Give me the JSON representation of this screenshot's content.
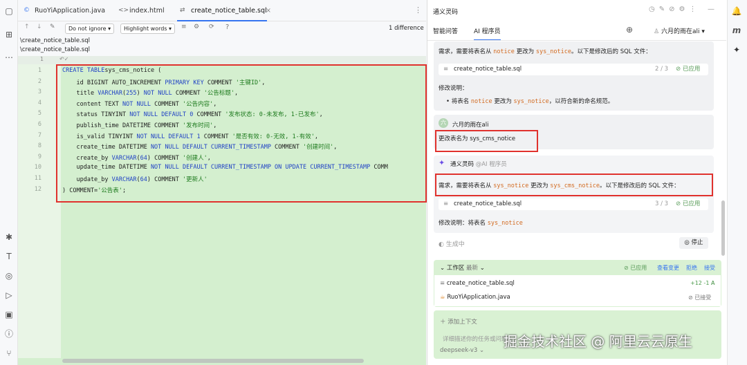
{
  "editor": {
    "tabs": [
      {
        "label": "RuoYiApplication.java",
        "icon": "java-icon"
      },
      {
        "label": "index.html",
        "icon": "html-icon"
      },
      {
        "label": "create_notice_table.sql",
        "icon": "diff-icon"
      }
    ],
    "toolbar": {
      "whitespace": "Do not ignore",
      "highlight": "Highlight words",
      "help": "?",
      "diff_count": "1 difference"
    },
    "paths": [
      "\\create_notice_table.sql",
      "\\create_notice_table.sql"
    ],
    "line_numbers": [
      "1",
      "2",
      "3",
      "4",
      "5",
      "6",
      "7",
      "8",
      "9",
      "10",
      "11",
      "12"
    ],
    "code": [
      [
        [
          "kw",
          "CREATE TABLE"
        ],
        [
          "",
          "sys_cms_notice ("
        ]
      ],
      [
        [
          "",
          "    id BIGINT AUTO_INCREMENT "
        ],
        [
          "kw",
          "PRIMARY KEY"
        ],
        [
          "",
          " COMMENT "
        ],
        [
          "str",
          "'主键ID'"
        ],
        [
          "",
          ","
        ]
      ],
      [
        [
          "",
          "    title "
        ],
        [
          "kw",
          "VARCHAR"
        ],
        [
          "",
          "("
        ],
        [
          "num",
          "255"
        ],
        [
          ") ",
          ""
        ],
        [
          "kw",
          "NOT NULL"
        ],
        [
          "",
          " COMMENT "
        ],
        [
          "str",
          "'公告标题'"
        ],
        [
          "",
          ","
        ]
      ],
      [
        [
          "",
          "    content TEXT "
        ],
        [
          "kw",
          "NOT NULL"
        ],
        [
          "",
          " COMMENT "
        ],
        [
          "str",
          "'公告内容'"
        ],
        [
          "",
          ","
        ]
      ],
      [
        [
          "",
          "    status TINYINT "
        ],
        [
          "kw",
          "NOT NULL DEFAULT 0"
        ],
        [
          "",
          " COMMENT "
        ],
        [
          "str",
          "'发布状态: 0-未发布, 1-已发布'"
        ],
        [
          "",
          ","
        ]
      ],
      [
        [
          "",
          "    publish_time DATETIME COMMENT "
        ],
        [
          "str",
          "'发布时间'"
        ],
        [
          "",
          ","
        ]
      ],
      [
        [
          "",
          "    is_valid TINYINT "
        ],
        [
          "kw",
          "NOT NULL DEFAULT 1"
        ],
        [
          "",
          " COMMENT "
        ],
        [
          "str",
          "'是否有效: 0-无效, 1-有效'"
        ],
        [
          "",
          ","
        ]
      ],
      [
        [
          "",
          "    create_time DATETIME "
        ],
        [
          "kw",
          "NOT NULL DEFAULT CURRENT_TIMESTAMP"
        ],
        [
          "",
          " COMMENT "
        ],
        [
          "str",
          "'创建时间'"
        ],
        [
          "",
          ","
        ]
      ],
      [
        [
          "",
          "    create_by "
        ],
        [
          "kw",
          "VARCHAR"
        ],
        [
          "",
          "("
        ],
        [
          "num",
          "64"
        ],
        [
          "",
          ") COMMENT "
        ],
        [
          "str",
          "'创建人'"
        ],
        [
          "",
          ","
        ]
      ],
      [
        [
          "",
          "    update_time DATETIME "
        ],
        [
          "kw",
          "NOT NULL DEFAULT CURRENT_TIMESTAMP ON UPDATE CURRENT_TIMESTAMP"
        ],
        [
          "",
          " COMM"
        ]
      ],
      [
        [
          "",
          "    update_by "
        ],
        [
          "kw",
          "VARCHAR"
        ],
        [
          "",
          "("
        ],
        [
          "num",
          "64"
        ],
        [
          "",
          ") COMMENT "
        ],
        [
          "str",
          "'更新人'"
        ]
      ],
      [
        [
          "",
          ") COMMENT="
        ],
        [
          "str",
          "'公告表'"
        ],
        [
          "",
          ";"
        ]
      ]
    ]
  },
  "assistant": {
    "title": "通义灵码",
    "tabs": [
      "智能问答",
      "AI 程序员"
    ],
    "user": "六月的雨在ali",
    "msg1": {
      "pre": "需求，需要将表名从 ",
      "from": "notice",
      "mid": " 更改为 ",
      "to": "sys_notice",
      "post": "。以下是修改后的 SQL 文件："
    },
    "file1": {
      "name": "create_notice_table.sql",
      "pages": "2 / 3",
      "status": "已应用"
    },
    "note1_title": "修改说明：",
    "note1": {
      "pre": "将表名 ",
      "from": "notice",
      "mid": " 更改为 ",
      "to": "sys_notice",
      "post": "，以符合新的命名规范。"
    },
    "user_msg": {
      "name": "六月的雨在ali",
      "avatar": "六",
      "text": "更改表名为 sys_cms_notice"
    },
    "bot": {
      "name": "通义灵码",
      "role": "@AI 程序员"
    },
    "msg2": {
      "pre": "需求，需要将表名从 ",
      "from": "sys_notice",
      "mid": " 更改为 ",
      "to": "sys_cms_notice",
      "post": "。以下是修改后的 SQL 文件："
    },
    "file2": {
      "name": "create_notice_table.sql",
      "pages": "3 / 3",
      "status": "已应用"
    },
    "note2": {
      "pre": "修改说明：将表名 ",
      "from": "sys_notice"
    },
    "generating": "生成中",
    "stop": "停止",
    "workspace": {
      "label": "工作区",
      "filter": "最新",
      "applied": "已应用",
      "view": "查看变更",
      "reject": "拒绝",
      "accept": "接受",
      "files": [
        {
          "name": "create_notice_table.sql",
          "diff": "+12 -1",
          "mark": "A"
        },
        {
          "name": "RuoYiApplication.java",
          "status": "已接受"
        }
      ]
    },
    "context": {
      "add": "添加上下文",
      "placeholder": "详细描述你的任务或问题",
      "model": "deepseek-v3"
    },
    "watermark": "掘金技术社区 @ 阿里云云原生"
  }
}
